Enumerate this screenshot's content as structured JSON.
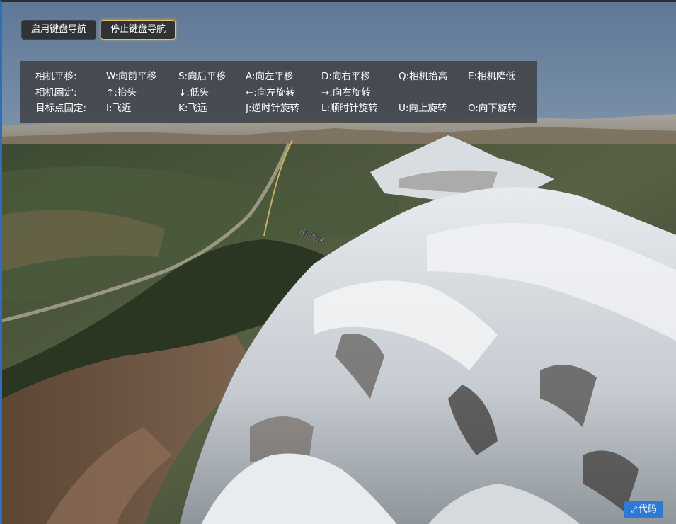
{
  "toolbar": {
    "start_label": "启用键盘导航",
    "stop_label": "停止键盘导航"
  },
  "help": {
    "rows": [
      {
        "title": "相机平移:",
        "items": [
          "W:向前平移",
          "S:向后平移",
          "A:向左平移",
          "D:向右平移",
          "Q:相机抬高",
          "E:相机降低"
        ]
      },
      {
        "title": "相机固定:",
        "items": [
          "↑:抬头",
          "↓:低头",
          "←:向左旋转",
          "→:向右旋转"
        ]
      },
      {
        "title": "目标点固定:",
        "items": [
          "I:飞近",
          "K:飞远",
          "J:逆时针旋转",
          "L:顺时针旋转",
          "U:向上旋转",
          "O:向下旋转"
        ]
      }
    ]
  },
  "code_badge": {
    "label": "代码",
    "icon": "expand-icon"
  },
  "scene": {
    "road_label": "虎跳峡"
  },
  "colors": {
    "accent": "#2c7ad6",
    "active_border": "#edbb68"
  }
}
